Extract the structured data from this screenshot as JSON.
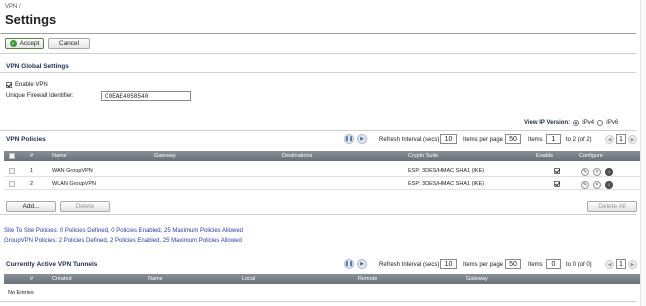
{
  "header": {
    "breadcrumb": "VPN /",
    "title": "Settings"
  },
  "toolbar": {
    "accept_label": "Accept",
    "cancel_label": "Cancel"
  },
  "global_settings": {
    "section_title": "VPN Global Settings",
    "enable_vpn_label": "Enable VPN",
    "enable_vpn_checked": true,
    "firewall_id_label": "Unique Firewall Identifier:",
    "firewall_id_value": "C0EAE4058540"
  },
  "ip_version": {
    "label": "View IP Version:",
    "options": [
      "IPv4",
      "IPv6"
    ],
    "selected": "IPv4"
  },
  "vpn_policies": {
    "section_title": "VPN Policies",
    "refresh_label": "Refresh Interval (secs)",
    "refresh_value": "10",
    "per_page_label": "Items per page",
    "per_page_value": "50",
    "items_label": "Items",
    "items_value": "1",
    "items_range": "to 2 (of 2)",
    "page_value": "1",
    "columns": [
      "#",
      "Name",
      "Gateway",
      "Destinations",
      "Crypto Suite",
      "Enable",
      "Configure"
    ],
    "rows": [
      {
        "num": "1",
        "name": "WAN GroupVPN",
        "gateway": "",
        "destinations": "",
        "crypto": "ESP: 3DES/HMAC SHA1 (IKE)",
        "enabled": true
      },
      {
        "num": "2",
        "name": "WLAN GroupVPN",
        "gateway": "",
        "destinations": "",
        "crypto": "ESP: 3DES/HMAC SHA1 (IKE)",
        "enabled": true
      }
    ],
    "add_label": "Add...",
    "delete_label": "Delete",
    "delete_all_label": "Delete All"
  },
  "summary": {
    "site_to_site": "Site To Site Policies: 0 Policies Defined, 0 Policies Enabled, 25 Maximum Policies Allowed",
    "group_vpn": "GroupVPN Policies: 2 Policies Defined, 2 Policies Enabled, 25 Maximum Policies Allowed"
  },
  "active_tunnels": {
    "section_title": "Currently Active VPN Tunnels",
    "refresh_label": "Refresh Interval (secs)",
    "refresh_value": "10",
    "per_page_label": "Items per page",
    "per_page_value": "50",
    "items_label": "Items",
    "items_value": "0",
    "items_range": "to 0 (of 0)",
    "page_value": "1",
    "columns": [
      "#",
      "Created",
      "Name",
      "Local",
      "Remote",
      "Gateway"
    ],
    "empty_text": "No Entries"
  },
  "colors": {
    "section_title": "#1d2d4d",
    "table_header": "#6b7178",
    "link": "#2a3ca8"
  }
}
